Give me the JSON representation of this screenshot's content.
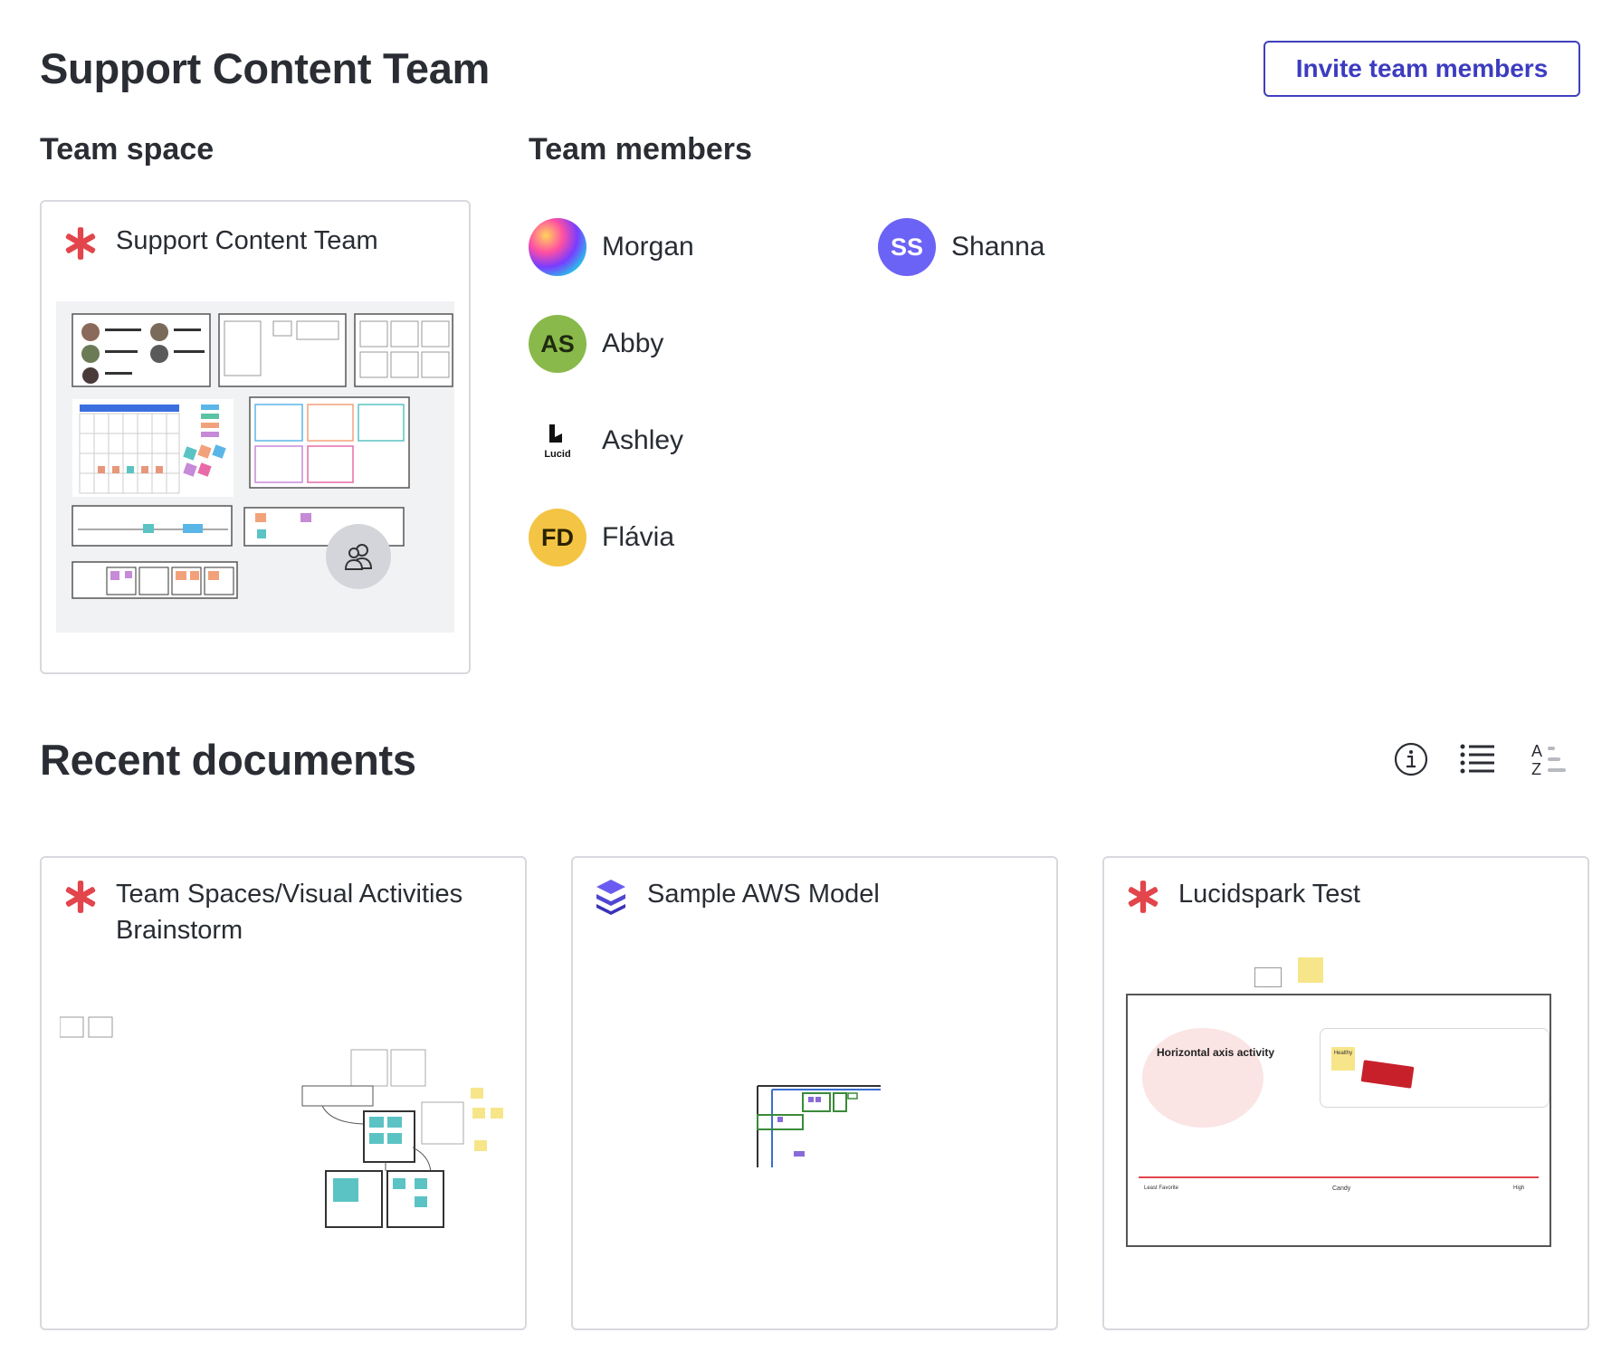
{
  "header": {
    "title": "Support Content Team",
    "invite_label": "Invite team members"
  },
  "team_space": {
    "heading": "Team space",
    "card_title": "Support Content Team",
    "icon": "lucidspark-asterisk-icon",
    "overlay_icon": "team-people-icon"
  },
  "team_members": {
    "heading": "Team members",
    "members": [
      {
        "name": "Morgan",
        "initials": "",
        "avatar": "abstract-image",
        "color": "#c24fd6"
      },
      {
        "name": "Abby",
        "initials": "AS",
        "avatar": "initials",
        "color": "#8ab94b"
      },
      {
        "name": "Ashley",
        "initials": "",
        "avatar": "lucid-logo",
        "logo_text": "Lucid",
        "color": "#111111"
      },
      {
        "name": "Flávia",
        "initials": "FD",
        "avatar": "initials",
        "color": "#f4c445"
      },
      {
        "name": "Shanna",
        "initials": "SS",
        "avatar": "initials",
        "color": "#6b63f6"
      }
    ]
  },
  "recent_documents": {
    "heading": "Recent documents",
    "tools": [
      "info-icon",
      "list-view-icon",
      "sort-az-icon"
    ],
    "documents": [
      {
        "title_line1": "Team Spaces/Visual Activities",
        "title_line2": "Brainstorm",
        "icon": "lucidspark-asterisk-icon"
      },
      {
        "title_line1": "Sample AWS Model",
        "title_line2": "",
        "icon": "lucidscale-layers-icon"
      },
      {
        "title_line1": "Lucidspark Test",
        "title_line2": "",
        "icon": "lucidspark-asterisk-icon",
        "preview_text": {
          "activity": "Horizontal axis activity",
          "axis_left": "Least Favorite",
          "axis_mid": "Candy",
          "axis_right": "High",
          "sticky": "Healthy"
        }
      }
    ]
  },
  "colors": {
    "accent": "#3c3cc0",
    "spark_red": "#e2454b",
    "border": "#d7d9de"
  }
}
